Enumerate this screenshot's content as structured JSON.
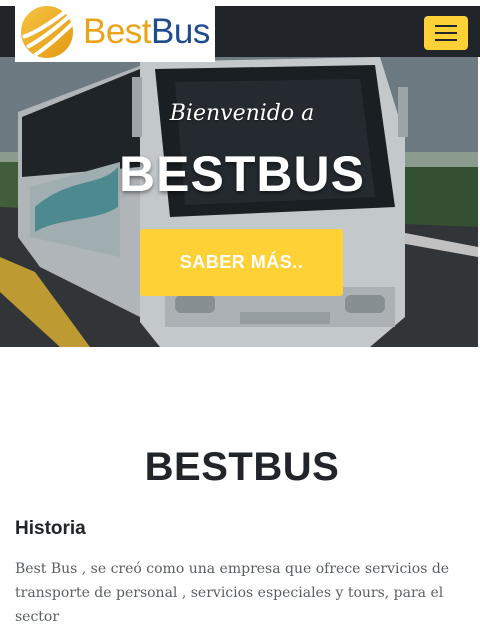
{
  "brand": {
    "name_part1": "Best",
    "name_part2": "Bus",
    "colors": {
      "orange": "#e9a41c",
      "blue": "#1f4c8f"
    },
    "icon": "logo-swoosh-icon"
  },
  "navbar": {
    "background": "#212529",
    "menu_icon": "hamburger-menu-icon",
    "menu_button_color": "#fed136"
  },
  "hero": {
    "tagline": "Bienvenido a",
    "heading": "BESTBUS",
    "cta_label": "SABER MÁS..",
    "cta_color": "#fed136"
  },
  "about": {
    "title": "BESTBUS",
    "subheading": "Historia",
    "paragraph": "Best Bus , se creó como una empresa que ofrece servicios de transporte de personal , servicios especiales y tours, para el sector"
  }
}
